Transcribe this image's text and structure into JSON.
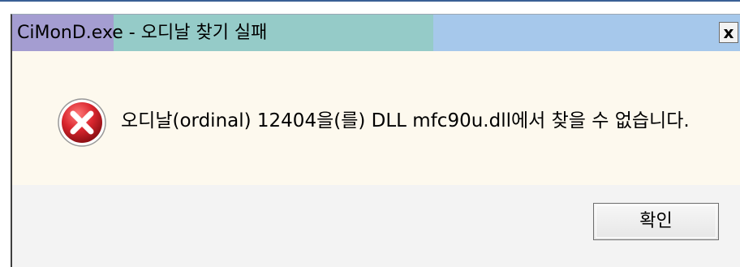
{
  "dialog": {
    "title": "CiMonD.exe - 오디날 찾기 실패",
    "close_label": "x",
    "message": "오디날(ordinal) 12404을(를) DLL mfc90u.dll에서 찾을 수 없습니다.",
    "icon": "error-icon",
    "ok_label": "확인"
  },
  "colors": {
    "titlebar": "#a6c8eb",
    "content_bg": "#fdf9ee",
    "footer_bg": "#f3f3f3",
    "error_red": "#d9262e"
  }
}
